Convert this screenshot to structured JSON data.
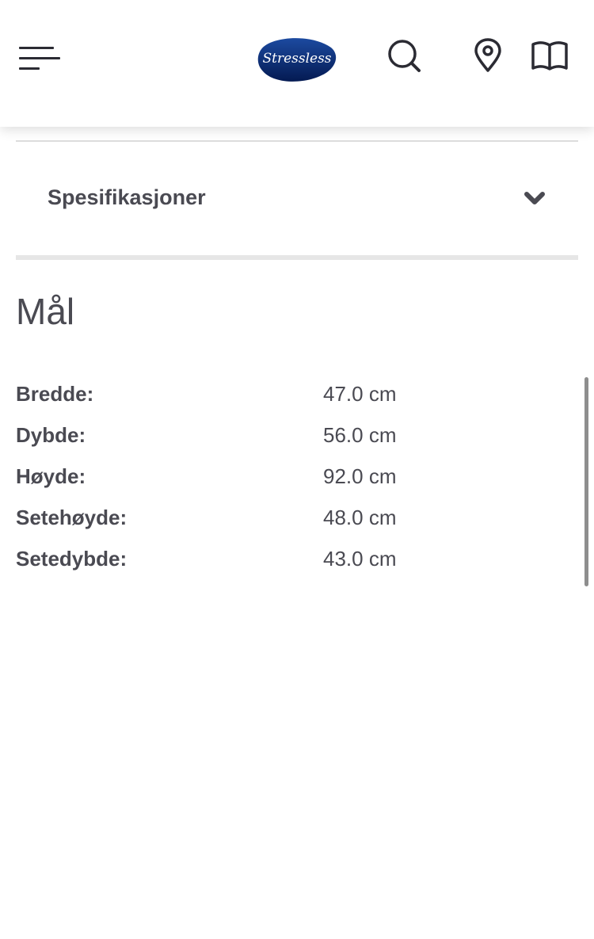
{
  "header": {
    "logo_text": "Stressless",
    "icons": {
      "menu": "hamburger-menu-icon",
      "search": "search-icon",
      "location": "map-pin-icon",
      "catalog": "open-book-icon"
    }
  },
  "accordion": {
    "title": "Spesifikasjoner",
    "icon": "chevron-down-icon"
  },
  "dimensions": {
    "title": "Mål",
    "rows": [
      {
        "label": "Bredde:",
        "value": "47.0 cm"
      },
      {
        "label": "Dybde:",
        "value": "56.0 cm"
      },
      {
        "label": "Høyde:",
        "value": "92.0 cm"
      },
      {
        "label": "Setehøyde:",
        "value": "48.0 cm"
      },
      {
        "label": "Setedybde:",
        "value": "43.0 cm"
      }
    ]
  },
  "colors": {
    "brand_navy": "#0a2a6b",
    "text": "#4a4a52",
    "divider": "#dddddd"
  }
}
